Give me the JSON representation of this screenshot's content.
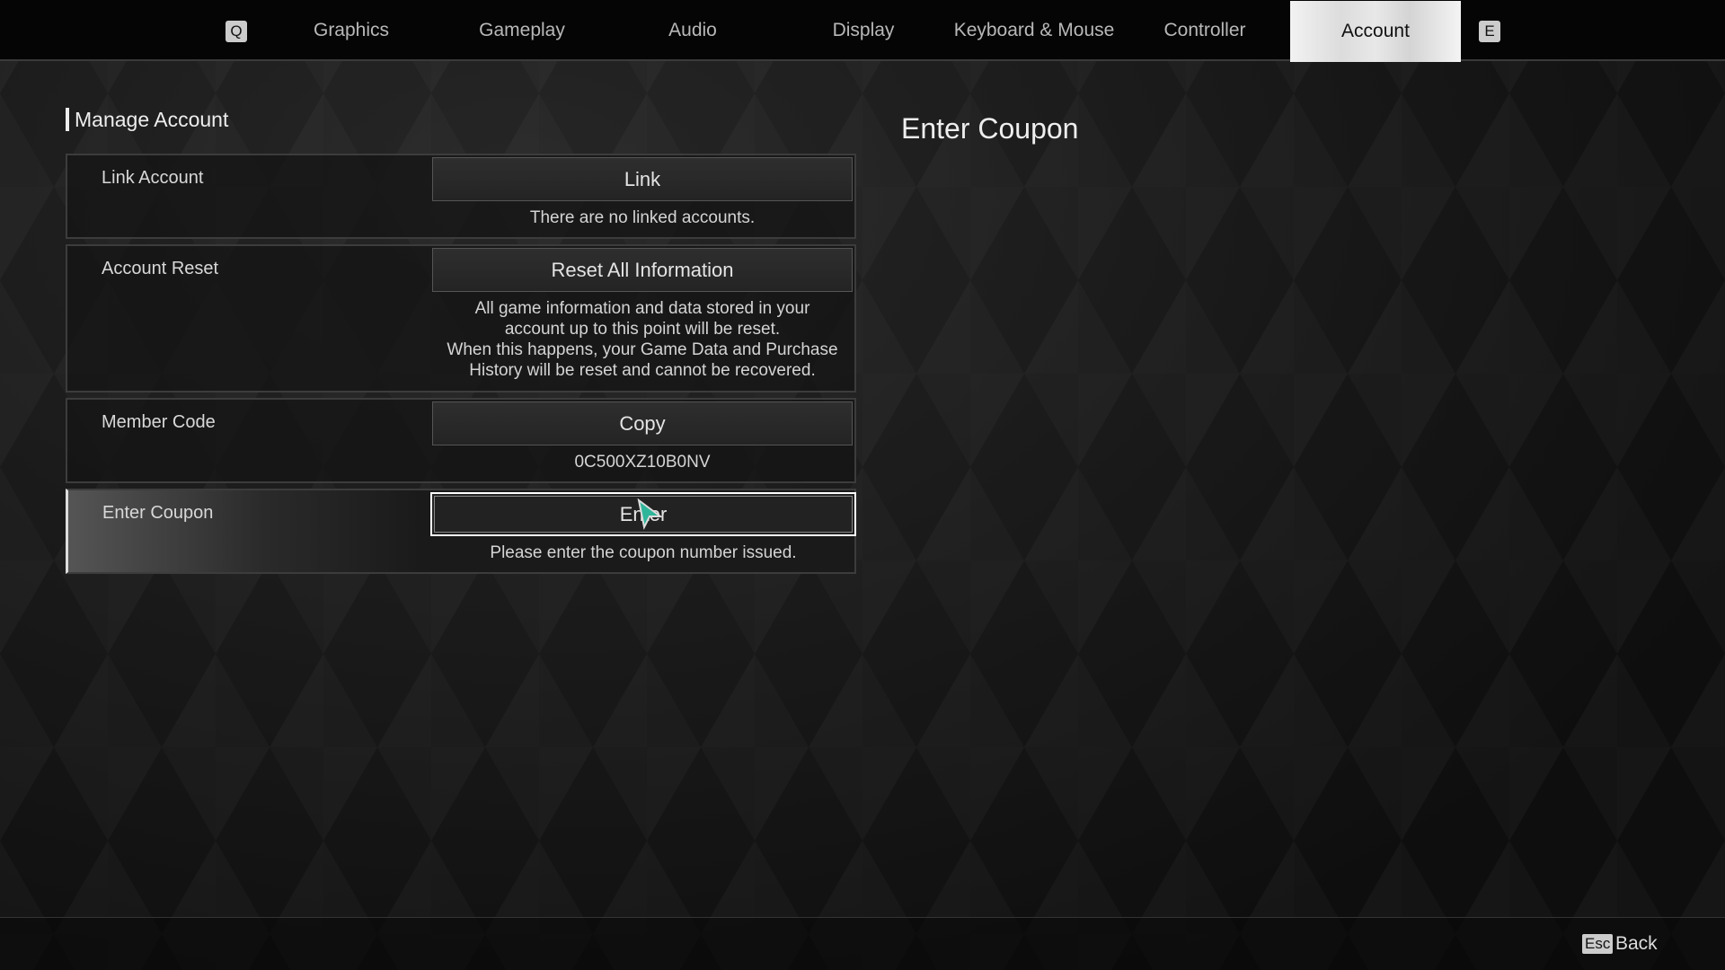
{
  "tabs": {
    "prev_key": "Q",
    "next_key": "E",
    "items": [
      {
        "label": "Graphics"
      },
      {
        "label": "Gameplay"
      },
      {
        "label": "Audio"
      },
      {
        "label": "Display"
      },
      {
        "label": "Keyboard & Mouse"
      },
      {
        "label": "Controller"
      },
      {
        "label": "Account",
        "active": true
      }
    ]
  },
  "section_title": "Manage Account",
  "rows": [
    {
      "label": "Link Account",
      "button": "Link",
      "desc": "There are no linked accounts."
    },
    {
      "label": "Account Reset",
      "button": "Reset All Information",
      "desc": "All game information and data stored in your account up to this point will be reset.",
      "desc2": "When this happens, your Game Data and Purchase History will be reset and cannot be recovered."
    },
    {
      "label": "Member Code",
      "button": "Copy",
      "desc": "0C500XZ10B0NV"
    },
    {
      "label": "Enter Coupon",
      "button": "Enter",
      "desc": "Please enter the coupon number issued.",
      "selected": true
    }
  ],
  "detail_title": "Enter Coupon",
  "footer": {
    "esc_key": "Esc",
    "back_label": "Back"
  },
  "colors": {
    "accent_cursor": "#2fb59a",
    "selected_border": "#ffffff"
  }
}
